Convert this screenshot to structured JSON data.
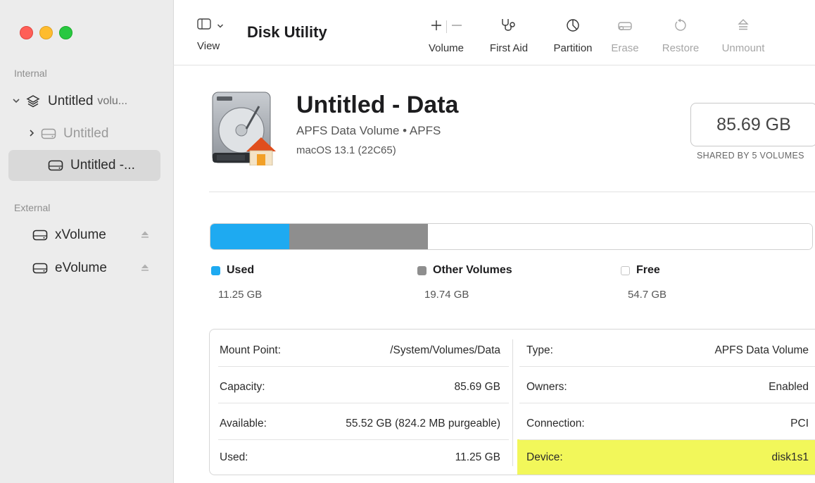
{
  "window": {
    "title": "Disk Utility",
    "view_label": "View"
  },
  "toolbar": {
    "items": [
      {
        "label": "Volume",
        "icon": "plus-minus-icon",
        "enabled": true
      },
      {
        "label": "First Aid",
        "icon": "stethoscope-icon",
        "enabled": true
      },
      {
        "label": "Partition",
        "icon": "pie-chart-icon",
        "enabled": true
      },
      {
        "label": "Erase",
        "icon": "eraser-icon",
        "enabled": false
      },
      {
        "label": "Restore",
        "icon": "restore-icon",
        "enabled": false
      },
      {
        "label": "Unmount",
        "icon": "eject-icon",
        "enabled": false
      }
    ]
  },
  "sidebar": {
    "internal_label": "Internal",
    "external_label": "External",
    "internal_items": [
      {
        "label": "Untitled",
        "suffix": "volu...",
        "icon": "layers-icon",
        "expanded": true
      },
      {
        "label": "Untitled",
        "icon": "disk-icon",
        "dimmed": true
      },
      {
        "label": "Untitled -...",
        "icon": "disk-icon",
        "selected": true
      }
    ],
    "external_items": [
      {
        "label": "xVolume",
        "icon": "disk-icon"
      },
      {
        "label": "eVolume",
        "icon": "disk-icon"
      }
    ]
  },
  "volume": {
    "name": "Untitled - Data",
    "subtitle": "APFS Data Volume • APFS",
    "os": "macOS 13.1 (22C65)",
    "capacity": "85.69 GB",
    "capacity_caption": "SHARED BY 5 VOLUMES"
  },
  "usage": {
    "segments": [
      {
        "name": "Used",
        "value": "11.25 GB",
        "gb": 11.25,
        "color": "#1eaaf1"
      },
      {
        "name": "Other Volumes",
        "value": "19.74 GB",
        "gb": 19.74,
        "color": "#8e8e8e"
      },
      {
        "name": "Free",
        "value": "54.7 GB",
        "gb": 54.7,
        "color": "#ffffff"
      }
    ]
  },
  "info": {
    "left": [
      {
        "key": "Mount Point:",
        "value": "/System/Volumes/Data"
      },
      {
        "key": "Capacity:",
        "value": "85.69 GB"
      },
      {
        "key": "Available:",
        "value": "55.52 GB (824.2 MB purgeable)"
      },
      {
        "key": "Used:",
        "value": "11.25 GB"
      }
    ],
    "right": [
      {
        "key": "Type:",
        "value": "APFS Data Volume"
      },
      {
        "key": "Owners:",
        "value": "Enabled"
      },
      {
        "key": "Connection:",
        "value": "PCI"
      },
      {
        "key": "Device:",
        "value": "disk1s1"
      }
    ],
    "highlight_color": "#f2f75a"
  }
}
